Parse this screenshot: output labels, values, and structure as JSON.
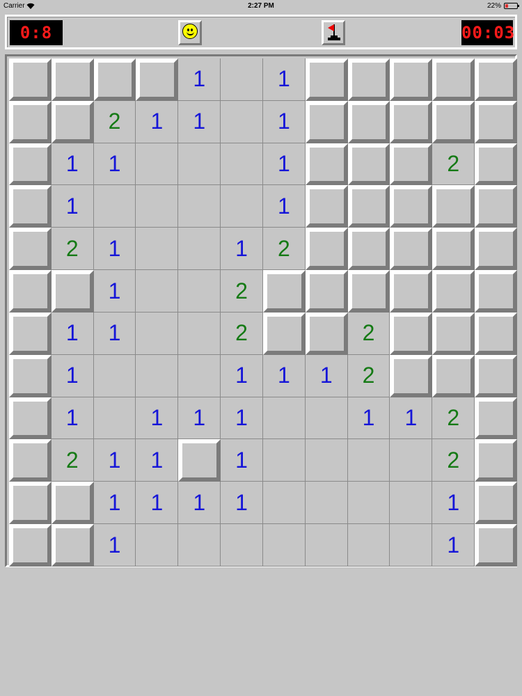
{
  "status_bar": {
    "carrier": "Carrier",
    "time": "2:27 PM",
    "battery_percent": "22%",
    "battery_level": 0.22
  },
  "toolbar": {
    "mines_remaining": "0:8",
    "timer": "00:03",
    "face": "smiley-face-icon",
    "mode_icon": "flag-icon"
  },
  "colors": {
    "number_1": "#1515d8",
    "number_2": "#157a15",
    "led": "#ff1a1a"
  },
  "board": {
    "rows": 12,
    "cols": 12,
    "grid": [
      "####1.1#####",
      "##211.1#####",
      "#11...1###2#",
      "#1....1#####",
      "#21..12#####",
      "##1..2######",
      "#11..2##2###",
      "#1...1112###",
      "#1.111..112#",
      "#211#1....2#",
      "##1111....1#",
      "##1.......1#"
    ]
  }
}
